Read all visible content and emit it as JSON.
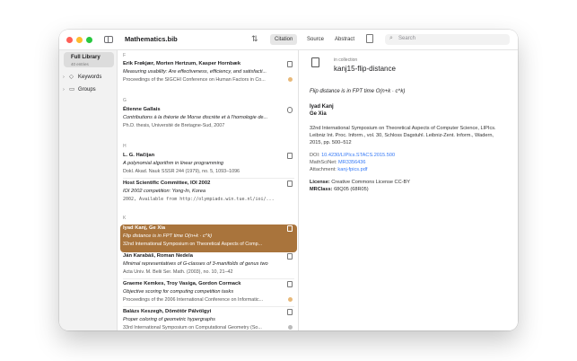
{
  "window": {
    "title": "Mathematics.bib"
  },
  "toolbar": {
    "segments": [
      "Citation",
      "Source",
      "Abstract"
    ],
    "search_placeholder": "Search"
  },
  "sidebar": {
    "library": {
      "title": "Full Library",
      "count": "40 entries"
    },
    "items": [
      {
        "label": "Keywords"
      },
      {
        "label": "Groups"
      }
    ]
  },
  "list": {
    "sections": [
      {
        "letter": "F"
      },
      {
        "letter": "G"
      },
      {
        "letter": "H"
      },
      {
        "letter": "K"
      }
    ],
    "entries": [
      {
        "authors": "Erik Frøkjær, Morten Hertzum, Kasper Hornbæk",
        "title": "Measuring usability: Are effectiveness, efficiency, and satisfacti...",
        "venue": "Proceedings of the SIGCHI Conference on Human Factors in Co..."
      },
      {
        "authors": "Étienne Gallais",
        "title": "Contributions à la théorie de Morse discrète et à l'homologie de...",
        "venue": "Ph.D. thesis, Université de Bretagne-Sud, 2007"
      },
      {
        "authors": "L. G. Hačijan",
        "title": "A polynomial algorithm in linear programming",
        "venue": "Dokl. Akad. Nauk SSSR 244 (1979), no. 5, 1093–1096"
      },
      {
        "authors": "Host Scientific Committee, IOI 2002",
        "title": "IOI 2002 competition: Yong-In, Korea",
        "venue": "2002, Available from http://olympiads.win.tue.nl/ioi/..."
      },
      {
        "authors": "Iyad Kanj, Ge Xia",
        "title": "Flip distance is in FPT time O(n+k · c^k)",
        "venue": "32nd International Symposium on Theoretical Aspects of Comp..."
      },
      {
        "authors": "Ján Karabáš, Roman Nedela",
        "title": "Minimal representatives of G-classes of 3-manifolds of genus two",
        "venue": "Acta Univ. M. Belii Ser. Math. (2003), no. 10, 21–42"
      },
      {
        "authors": "Graeme Kemkes, Troy Vasiga, Gordon Cormack",
        "title": "Objective scoring for computing competition tasks",
        "venue": "Proceedings of the 2006 International Conference on Informatic..."
      },
      {
        "authors": "Balázs Keszegh, Dömötör Pálvölgyi",
        "title": "Proper coloring of geometric hypergraphs",
        "venue": "33rd International Symposium on Computational Geometry (So..."
      }
    ]
  },
  "detail": {
    "collection_label": "in collection",
    "key": "kanj15-flip-distance",
    "title": "Flip distance is in FPT time O(n+k · c^k)",
    "authors": [
      "Iyad Kanj",
      "Ge Xia"
    ],
    "venue_lines": [
      "32nd International Symposium on Theoretical Aspects of Computer Science, LIPIcs.",
      "Leibniz Int. Proc. Inform., vol. 30, Schloss Dagstuhl. Leibniz-Zent. Inform., Wadern,",
      "2015, pp. 500–512"
    ],
    "doi_label": "DOI:",
    "doi": "10.4230/LIPIcs.STACS.2015.500",
    "mathscinet_label": "MathSciNet:",
    "mathscinet": "MR3356436",
    "attachment_label": "Attachment:",
    "attachment": "kanj-fpics.pdf",
    "license_label": "License:",
    "license": "Creative Commons License CC-BY",
    "mrclass_label": "MRClass:",
    "mrclass": "68Q05 (68R05)"
  },
  "colors": {
    "selection": "#a9743c",
    "link": "#3478f6"
  }
}
